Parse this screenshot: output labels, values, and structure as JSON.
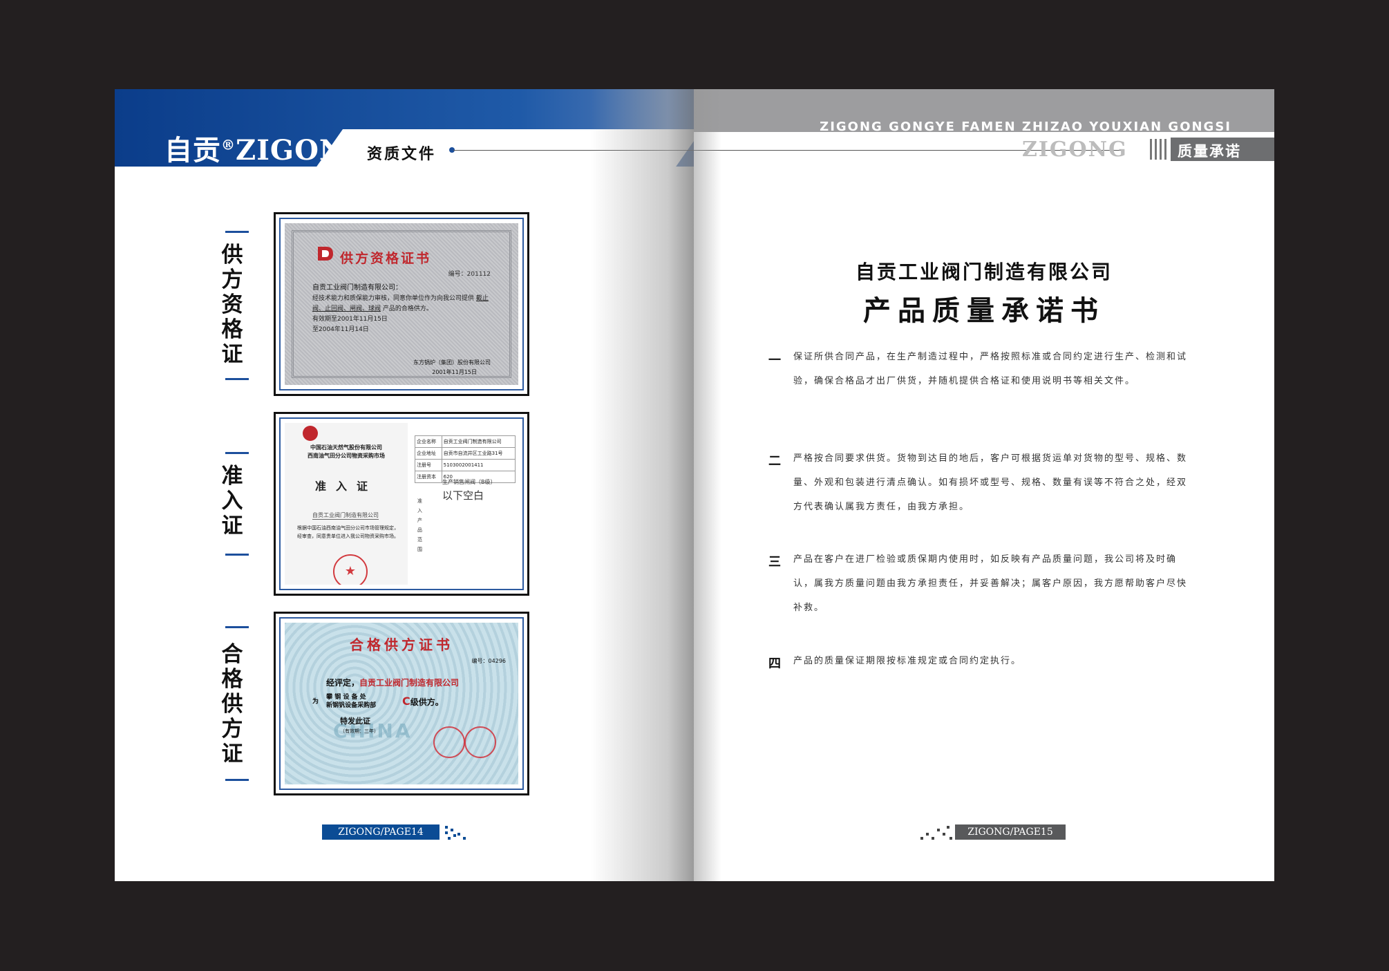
{
  "left_page": {
    "brand": "自贡",
    "brand_reg": "®",
    "brand_en": "ZIGONG",
    "section_title": "资质文件",
    "labels": [
      "供方资格证",
      "准入证",
      "合格供方证"
    ],
    "certificates": {
      "supplier_qualification": {
        "title": "供方资格证书",
        "number": "编号：201112",
        "to": "自贡工业阀门制造有限公司：",
        "body": "经技术能力和质保能力审核，同意你单位作为向我公司提供",
        "products": "截止阀、止回阀、闸阀、球阀",
        "body_end": "产品的合格供方。",
        "validity_1": "有效期至2001年11月15日",
        "validity_2": "至2004年11月14日",
        "issuer": "东方锅炉（集团）股份有限公司",
        "date": "2001年11月15日"
      },
      "access": {
        "org_1": "中国石油天然气股份有限公司",
        "org_2": "西南油气田分公司物资采购市场",
        "title": "准入证",
        "company": "自贡工业阀门制造有限公司",
        "body": "根据中国石油西南油气田分公司市场管理规定，经审查，同意贵单位进入我公司物资采购市场。",
        "seal": "★",
        "table_rows": [
          [
            "企业名称",
            "自贡工业阀门制造有限公司"
          ],
          [
            "企业地址",
            "自贡市自流井区工业路31号"
          ],
          [
            "注册号",
            "5103002001411"
          ],
          [
            "注册资本",
            "620"
          ]
        ],
        "scope_label": "生产销售闸阀（B级）",
        "blank_note": "以下空白",
        "side_label": "准入产品范围"
      },
      "qualified_supplier": {
        "title": "合格供方证书",
        "number": "编号：04296",
        "line_prefix": "经评定，",
        "company": "自贡工业阀门制造有限公司",
        "for_label": "为",
        "buyer_1": "攀 钢 设 备 处",
        "buyer_2": "新钢钒设备采购部",
        "grade": "C",
        "grade_suffix": "级供方。",
        "issue": "特发此证",
        "validity": "（有效期：三年）",
        "watermark": "CHINA"
      }
    },
    "footer": "ZIGONG/PAGE14"
  },
  "right_page": {
    "header_en": "ZIGONG GONGYE FAMEN ZHIZAO YOUXIAN GONGSI",
    "header_brand": "ZIGONG",
    "section_title": "质量承诺",
    "company_title": "自贡工业阀门制造有限公司",
    "doc_title": "产品质量承诺书",
    "items": [
      {
        "num": "一",
        "text": "保证所供合同产品，在生产制造过程中，严格按照标准或合同约定进行生产、检测和试验，确保合格品才出厂供货，并随机提供合格证和使用说明书等相关文件。"
      },
      {
        "num": "二",
        "text": "严格按合同要求供货。货物到达目的地后，客户可根据货运单对货物的型号、规格、数量、外观和包装进行清点确认。如有损坏或型号、规格、数量有误等不符合之处，经双方代表确认属我方责任，由我方承担。"
      },
      {
        "num": "三",
        "text": "产品在客户在进厂检验或质保期内使用时，如反映有产品质量问题，我公司将及时确认，属我方质量问题由我方承担责任，并妥善解决；属客户原因，我方愿帮助客户尽快补救。"
      },
      {
        "num": "四",
        "text": "产品的质量保证期限按标准规定或合同约定执行。"
      }
    ],
    "footer": "ZIGONG/PAGE15"
  },
  "colors": {
    "brand_blue": "#0b3d8a",
    "header_gray": "#9d9d9f",
    "seal_red": "#c0272d",
    "background": "#231f20"
  },
  "icons": [
    "registered-mark",
    "bullet-dot",
    "pixel-decoration",
    "company-logo",
    "red-seal"
  ]
}
